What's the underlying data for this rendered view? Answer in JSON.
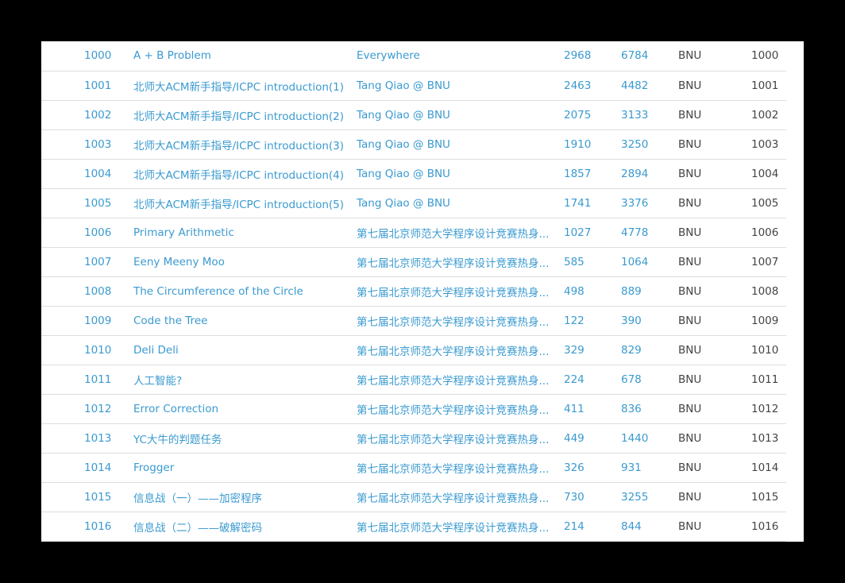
{
  "colors": {
    "link": "#3a9ad0",
    "text": "#444444",
    "row_border": "#dddddd",
    "background": "#000000",
    "panel": "#ffffff"
  },
  "rows": [
    {
      "pid": "1000",
      "title": "A + B Problem",
      "source": "Everywhere",
      "ac": "2968",
      "submit": "6784",
      "oj": "BNU",
      "vid": "1000"
    },
    {
      "pid": "1001",
      "title": "北师大ACM新手指导/ICPC introduction(1)",
      "source": "Tang Qiao @ BNU",
      "ac": "2463",
      "submit": "4482",
      "oj": "BNU",
      "vid": "1001"
    },
    {
      "pid": "1002",
      "title": "北师大ACM新手指导/ICPC introduction(2)",
      "source": "Tang Qiao @ BNU",
      "ac": "2075",
      "submit": "3133",
      "oj": "BNU",
      "vid": "1002"
    },
    {
      "pid": "1003",
      "title": "北师大ACM新手指导/ICPC introduction(3)",
      "source": "Tang Qiao @ BNU",
      "ac": "1910",
      "submit": "3250",
      "oj": "BNU",
      "vid": "1003"
    },
    {
      "pid": "1004",
      "title": "北师大ACM新手指导/ICPC introduction(4)",
      "source": "Tang Qiao @ BNU",
      "ac": "1857",
      "submit": "2894",
      "oj": "BNU",
      "vid": "1004"
    },
    {
      "pid": "1005",
      "title": "北师大ACM新手指导/ICPC introduction(5)",
      "source": "Tang Qiao @ BNU",
      "ac": "1741",
      "submit": "3376",
      "oj": "BNU",
      "vid": "1005"
    },
    {
      "pid": "1006",
      "title": "Primary Arithmetic",
      "source": "第七届北京师范大学程序设计竞赛热身...",
      "ac": "1027",
      "submit": "4778",
      "oj": "BNU",
      "vid": "1006"
    },
    {
      "pid": "1007",
      "title": "Eeny Meeny Moo",
      "source": "第七届北京师范大学程序设计竞赛热身...",
      "ac": "585",
      "submit": "1064",
      "oj": "BNU",
      "vid": "1007"
    },
    {
      "pid": "1008",
      "title": "The Circumference of the Circle",
      "source": "第七届北京师范大学程序设计竞赛热身...",
      "ac": "498",
      "submit": "889",
      "oj": "BNU",
      "vid": "1008"
    },
    {
      "pid": "1009",
      "title": "Code the Tree",
      "source": "第七届北京师范大学程序设计竞赛热身...",
      "ac": "122",
      "submit": "390",
      "oj": "BNU",
      "vid": "1009"
    },
    {
      "pid": "1010",
      "title": "Deli Deli",
      "source": "第七届北京师范大学程序设计竞赛热身...",
      "ac": "329",
      "submit": "829",
      "oj": "BNU",
      "vid": "1010"
    },
    {
      "pid": "1011",
      "title": "人工智能?",
      "source": "第七届北京师范大学程序设计竞赛热身...",
      "ac": "224",
      "submit": "678",
      "oj": "BNU",
      "vid": "1011"
    },
    {
      "pid": "1012",
      "title": "Error Correction",
      "source": "第七届北京师范大学程序设计竞赛热身...",
      "ac": "411",
      "submit": "836",
      "oj": "BNU",
      "vid": "1012"
    },
    {
      "pid": "1013",
      "title": "YC大牛的判题任务",
      "source": "第七届北京师范大学程序设计竞赛热身...",
      "ac": "449",
      "submit": "1440",
      "oj": "BNU",
      "vid": "1013"
    },
    {
      "pid": "1014",
      "title": "Frogger",
      "source": "第七届北京师范大学程序设计竞赛热身...",
      "ac": "326",
      "submit": "931",
      "oj": "BNU",
      "vid": "1014"
    },
    {
      "pid": "1015",
      "title": "信息战（一）——加密程序",
      "source": "第七届北京师范大学程序设计竞赛热身...",
      "ac": "730",
      "submit": "3255",
      "oj": "BNU",
      "vid": "1015"
    },
    {
      "pid": "1016",
      "title": "信息战（二）——破解密码",
      "source": "第七届北京师范大学程序设计竞赛热身...",
      "ac": "214",
      "submit": "844",
      "oj": "BNU",
      "vid": "1016"
    }
  ]
}
